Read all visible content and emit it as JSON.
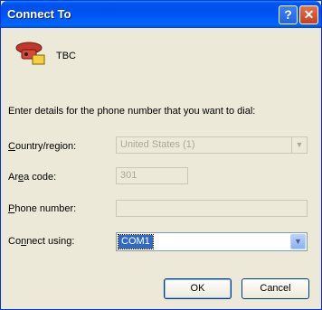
{
  "window": {
    "title": "Connect To",
    "help_glyph": "?",
    "close_glyph": "✕"
  },
  "connection": {
    "name": "TBC",
    "icon": "phone-icon"
  },
  "instructions": "Enter details for the phone number that you want to dial:",
  "country": {
    "label_pre": "",
    "label_u": "C",
    "label_post": "ountry/region:",
    "value": "United States (1)"
  },
  "area": {
    "label_pre": "Ar",
    "label_u": "e",
    "label_post": "a code:",
    "value": "301"
  },
  "phone": {
    "label_pre": "",
    "label_u": "P",
    "label_post": "hone number:",
    "value": ""
  },
  "connect": {
    "label_pre": "Co",
    "label_u": "n",
    "label_post": "nect using:",
    "value": "COM1"
  },
  "buttons": {
    "ok": "OK",
    "cancel": "Cancel"
  }
}
